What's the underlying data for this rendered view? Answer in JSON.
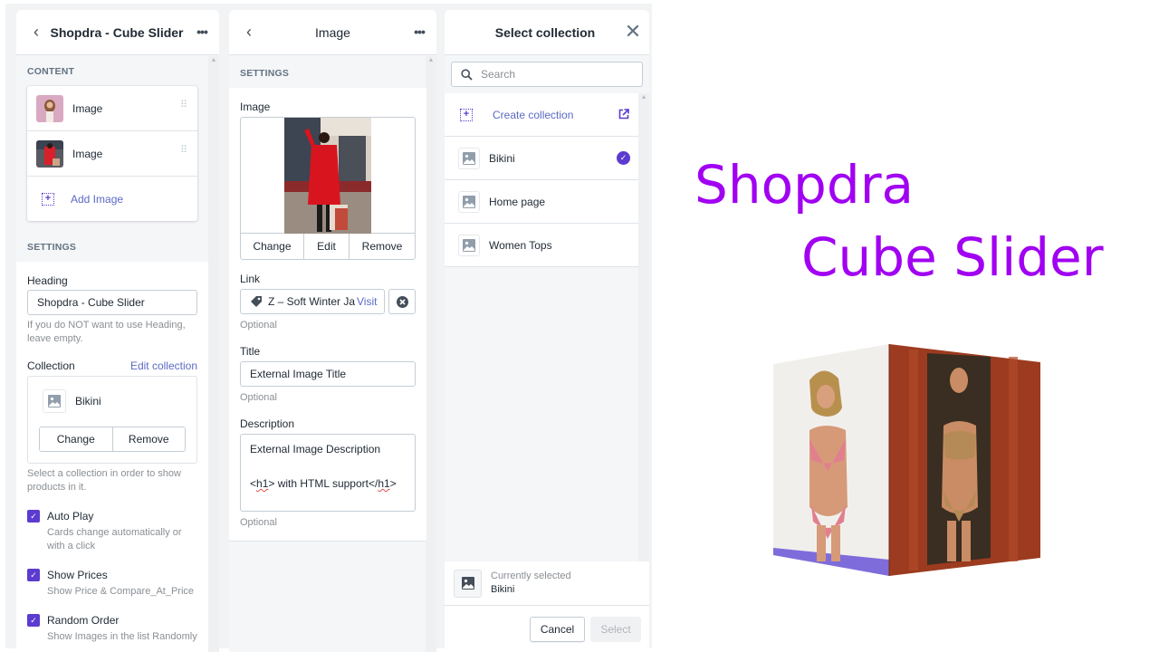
{
  "panel_block": {
    "header": {
      "title": "Shopdra - Cube Slider",
      "back_icon": "chevron-left-icon",
      "more_icon": "more-horizontal-icon"
    },
    "content": {
      "section_title": "CONTENT",
      "items": [
        {
          "label": "Image",
          "thumb": "woman-pink-background"
        },
        {
          "label": "Image",
          "thumb": "woman-red-coat"
        }
      ],
      "add_label": "Add Image"
    },
    "settings": {
      "section_title": "SETTINGS",
      "heading_label": "Heading",
      "heading_value": "Shopdra - Cube Slider",
      "heading_help": "If you do NOT want to use Heading, leave empty.",
      "collection_label": "Collection",
      "edit_collection": "Edit collection",
      "collection_name": "Bikini",
      "change_label": "Change",
      "remove_label": "Remove",
      "collection_help": "Select a collection in order to show products in it.",
      "checkboxes": [
        {
          "label": "Auto Play",
          "desc": "Cards change automatically or with a click",
          "checked": true
        },
        {
          "label": "Show Prices",
          "desc": "Show Price & Compare_At_Price",
          "checked": true
        },
        {
          "label": "Random Order",
          "desc": "Show Images in the list Randomly",
          "checked": true
        }
      ]
    }
  },
  "panel_image": {
    "header": {
      "title": "Image"
    },
    "section_title": "SETTINGS",
    "image_label": "Image",
    "image_buttons": [
      "Change",
      "Edit",
      "Remove"
    ],
    "link_label": "Link",
    "link_value": "Z – Soft Winter Jacket",
    "link_visit": "Visit",
    "link_help": "Optional",
    "title_label": "Title",
    "title_value": "External Image Title",
    "title_help": "Optional",
    "description_label": "Description",
    "description_line1": "External Image Description",
    "description_line2_pre": "<",
    "description_line2_h1a": "h1",
    "description_line2_mid": "> with HTML support</",
    "description_line2_h1b": "h1",
    "description_line2_post": ">",
    "description_help": "Optional"
  },
  "panel_select": {
    "header": {
      "title": "Select collection"
    },
    "search_placeholder": "Search",
    "create_label": "Create collection",
    "collections": [
      {
        "label": "Bikini",
        "selected": true
      },
      {
        "label": "Home page",
        "selected": false
      },
      {
        "label": "Women Tops",
        "selected": false
      }
    ],
    "currently_selected_label": "Currently selected",
    "currently_selected_value": "Bikini",
    "cancel_label": "Cancel",
    "select_label": "Select"
  },
  "showcase": {
    "title_line1": "Shopdra",
    "title_line2": "Cube Slider",
    "brand_color": "#a100f2",
    "accent_color": "#5c3bd0"
  }
}
